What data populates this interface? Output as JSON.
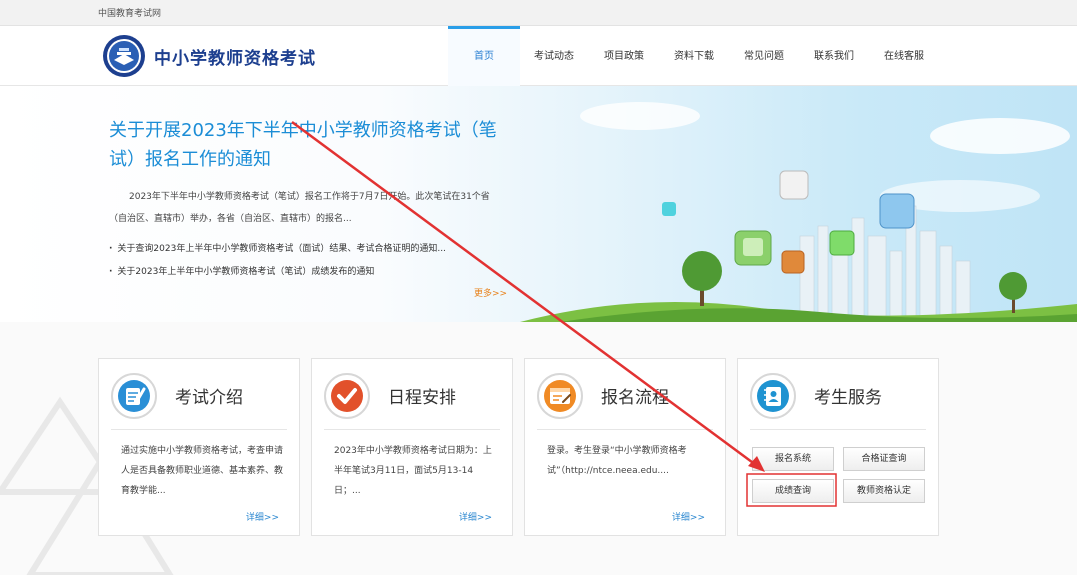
{
  "topbar": {
    "site_name": "中国教育考试网"
  },
  "header": {
    "brand": "中小学教师资格考试",
    "nav": [
      "首页",
      "考试动态",
      "项目政策",
      "资料下载",
      "常见问题",
      "联系我们",
      "在线客服"
    ],
    "active_index": 0
  },
  "banner": {
    "title": "关于开展2023年下半年中小学教师资格考试（笔试）报名工作的通知",
    "summary": "2023年下半年中小学教师资格考试（笔试）报名工作将于7月7日开始。此次笔试在31个省（自治区、直辖市）举办，各省（自治区、直辖市）的报名...",
    "links": [
      "关于查询2023年上半年中小学教师资格考试（面试）结果、考试合格证明的通知...",
      "关于2023年上半年中小学教师资格考试（笔试）成绩发布的通知"
    ],
    "more": "更多>>"
  },
  "cards": [
    {
      "title": "考试介绍",
      "desc": "通过实施中小学教师资格考试，考查申请人是否具备教师职业道德、基本素养、教育教学能...",
      "more": "详细>>"
    },
    {
      "title": "日程安排",
      "desc": "2023年中小学教师资格考试日期为：上半年笔试3月11日，面试5月13-14日；...",
      "more": "详细>>"
    },
    {
      "title": "报名流程",
      "desc": "登录。考生登录“中小学教师资格考试”（http://ntce.neea.edu....",
      "more": "详细>>"
    },
    {
      "title": "考生服务"
    }
  ],
  "services": [
    "报名系统",
    "合格证查询",
    "成绩查询",
    "教师资格认定"
  ],
  "highlighted_service": "成绩查询",
  "colors": {
    "accent": "#2a9ee8",
    "brand": "#1d3f8f",
    "highlight": "#e23232",
    "more_orange": "#e8821b"
  }
}
